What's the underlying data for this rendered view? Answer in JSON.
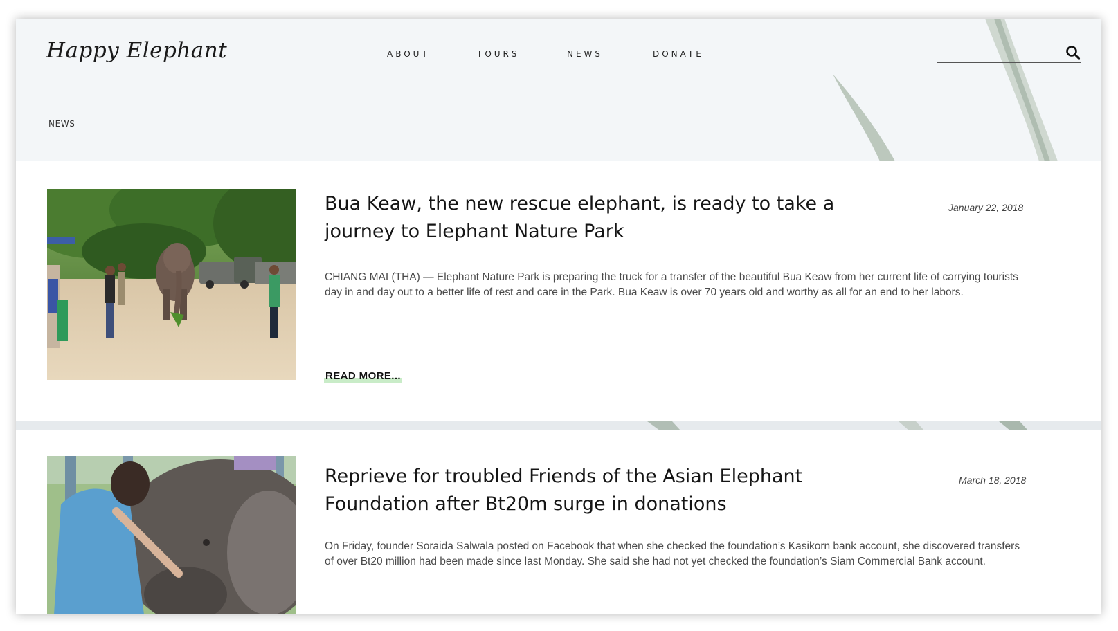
{
  "site": {
    "logo": "Happy Elephant"
  },
  "nav": {
    "items": [
      {
        "label": "ABOUT"
      },
      {
        "label": "TOURS"
      },
      {
        "label": "NEWS"
      },
      {
        "label": "DONATE"
      }
    ]
  },
  "search": {
    "value": "",
    "icon": "search-icon"
  },
  "breadcrumb": {
    "label": "NEWS"
  },
  "articles": [
    {
      "title": "Bua Keaw, the new rescue elephant, is ready to take a journey to Elephant Nature Park",
      "date": "January 22, 2018",
      "excerpt": "CHIANG MAI (THA) — Elephant Nature Park is preparing the truck for a transfer of the beautiful Bua Keaw from her current life of carrying tourists day in and day out to a better life of rest and care in the Park. Bua Keaw is over 70 years old and worthy as all for an end to her labors.",
      "read_more": "READ MORE..."
    },
    {
      "title": "Reprieve for troubled Friends of the Asian Elephant Foundation after Bt20m surge in donations",
      "date": "March 18, 2018",
      "excerpt": "On Friday, founder Soraida Salwala posted on Facebook that when she checked the foundation’s Kasikorn bank account, she discovered transfers of over Bt20 million had been made since last Monday. She said she had not yet checked the foundation’s Siam Commercial Bank account."
    }
  ],
  "colors": {
    "header_bg": "#f3f6f8",
    "card_bg": "#ffffff",
    "read_more_highlight": "#c9ecc8",
    "text": "#151515"
  }
}
